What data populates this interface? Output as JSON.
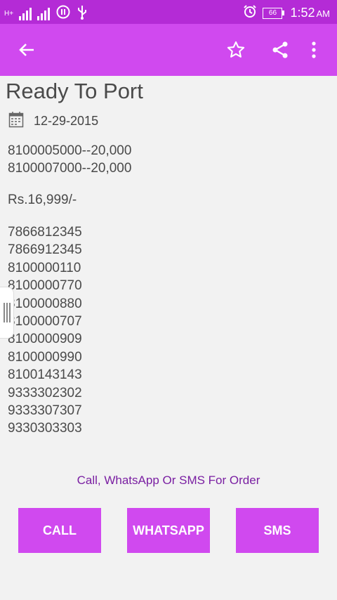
{
  "status_bar": {
    "time": "1:52",
    "ampm": "AM",
    "battery": "66",
    "network_label": "H+"
  },
  "app_bar": {
    "back_icon": "arrow-back-icon",
    "star_icon": "star-outline-icon",
    "share_icon": "share-icon",
    "more_icon": "more-vert-icon",
    "color": "#d049ef"
  },
  "post": {
    "title": "Ready To Port",
    "date": "12-29-2015",
    "ranges": [
      "8100005000--20,000",
      "8100007000--20,000"
    ],
    "price": "Rs.16,999/-",
    "numbers": [
      "7866812345",
      "7866912345",
      "8100000110",
      "8100000770",
      "8100000880",
      "8100000707",
      "8100000909",
      "8100000990",
      "8100143143",
      "9333302302",
      "9333307307",
      "9330303303"
    ]
  },
  "cta_text": "Call, WhatsApp Or SMS For Order",
  "buttons": {
    "call": "CALL",
    "whatsapp": "WHATSAPP",
    "sms": "SMS"
  }
}
